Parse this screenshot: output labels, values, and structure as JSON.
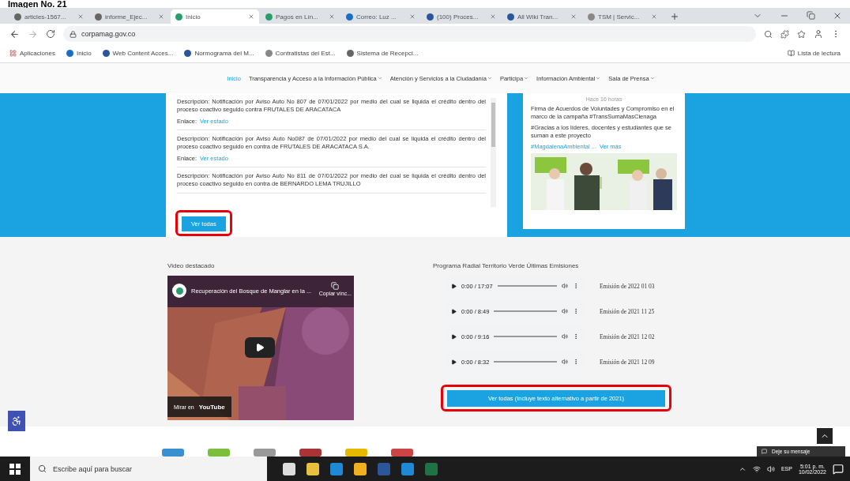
{
  "caption": "Imagen No. 21",
  "browser": {
    "tabs": [
      {
        "label": "articles-1567...",
        "selected": false
      },
      {
        "label": "informe_Ejec...",
        "selected": false
      },
      {
        "label": "Inicio",
        "selected": true
      },
      {
        "label": "Pagos en Lín...",
        "selected": false
      },
      {
        "label": "Correo: Luz ...",
        "selected": false
      },
      {
        "label": "(100) Proces...",
        "selected": false
      },
      {
        "label": "All Wiki Tran...",
        "selected": false
      },
      {
        "label": "TSM | Servic...",
        "selected": false
      }
    ],
    "url": "corpamag.gov.co",
    "bookmarks": [
      "Aplicaciones",
      "Inicio",
      "Web Content Acces...",
      "Normograma del M...",
      "Contratistas del Est...",
      "Sistema de Recepci..."
    ],
    "reading_list": "Lista de lectura"
  },
  "nav": [
    "Inicio",
    "Transparencia y Acceso a la Información Pública",
    "Atención y Servicios a la Ciudadanía",
    "Participa",
    "Información Ambiental",
    "Sala de Prensa"
  ],
  "notices": {
    "items": [
      {
        "label": "Descripción:",
        "text": "Notificación por Aviso Auto No 807 de 07/01/2022 por medio del cual se liquida el crédito dentro del proceso coactivo seguido contra FRUTALES DE ARACATACA",
        "link_label": "Enlace:",
        "link": "Ver estado"
      },
      {
        "label": "Descripción:",
        "text": "Notificación por Aviso Auto No087 de 07/01/2022 por medio del cual se liquida el crédito dentro del proceso coactivo seguido en contra de FRUTALES DE ARACATACA S.A.",
        "link_label": "Enlace:",
        "link": "Ver estado"
      },
      {
        "label": "Descripción:",
        "text": "Notificación por Aviso Auto No 811 de 07/01/2022 por medio del cual se liquida el crédito dentro del proceso coactivo seguido en contra de BERNARDO LEMA TRUJILLO"
      }
    ],
    "button": "Ver todas"
  },
  "post": {
    "time": "Hace 16 horas",
    "paragraphs": [
      "Firma de Acuerdos de Voluntades y Compromiso en el marco de la campaña #TransSumaMasCienaga",
      "#Gracias a los líderes, docentes y estudiantes que se suman a este proyecto"
    ],
    "tags": "#MagdalenaAmbiental ...",
    "more": "Ver más"
  },
  "video": {
    "heading": "Video destacado",
    "title": "Recuperación del Bosque de Manglar en la ...",
    "copy": "Copiar vínc...",
    "watch_on": "Mirar en",
    "brand": "YouTube"
  },
  "radio": {
    "heading": "Programa Radial Territorio Verde Últimas Emisiones",
    "episodes": [
      {
        "time": "0:00 / 17:07",
        "title": "Emisión de 2022 01 03"
      },
      {
        "time": "0:00 / 8:49",
        "title": "Emisión de 2021 11 25"
      },
      {
        "time": "0:00 / 9:16",
        "title": "Emisión de 2021 12 02"
      },
      {
        "time": "0:00 / 8:32",
        "title": "Emisión de 2021 12 09"
      }
    ],
    "button": "Ver todas (Incluye texto alternativo a partir de 2021)"
  },
  "chat": "Deje su mensaje",
  "taskbar": {
    "search": "Escribe aquí para buscar",
    "language": "ESP",
    "time": "5:01 p. m.",
    "date": "10/02/2022"
  }
}
